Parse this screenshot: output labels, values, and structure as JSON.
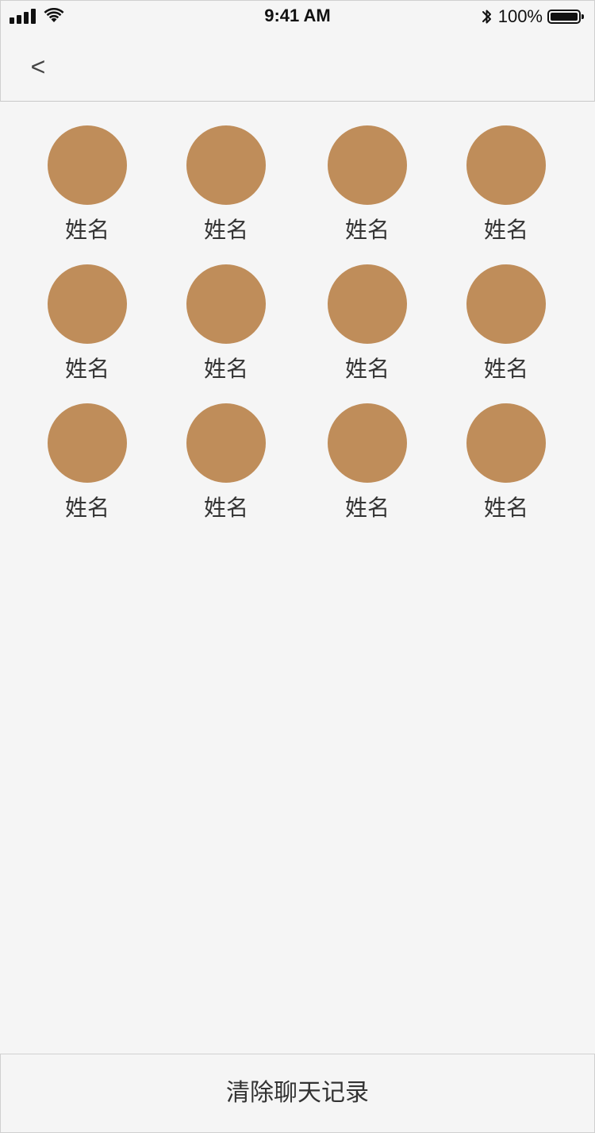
{
  "status_bar": {
    "time": "9:41 AM",
    "battery_percent": "100%",
    "battery_level": 1.0,
    "icons": [
      "signal-icon",
      "wifi-icon",
      "bluetooth-icon",
      "battery-icon"
    ]
  },
  "nav": {
    "back_label": "<"
  },
  "members": [
    {
      "name": "姓名",
      "avatar_color": "#bf8d5a"
    },
    {
      "name": "姓名",
      "avatar_color": "#bf8d5a"
    },
    {
      "name": "姓名",
      "avatar_color": "#bf8d5a"
    },
    {
      "name": "姓名",
      "avatar_color": "#bf8d5a"
    },
    {
      "name": "姓名",
      "avatar_color": "#bf8d5a"
    },
    {
      "name": "姓名",
      "avatar_color": "#bf8d5a"
    },
    {
      "name": "姓名",
      "avatar_color": "#bf8d5a"
    },
    {
      "name": "姓名",
      "avatar_color": "#bf8d5a"
    },
    {
      "name": "姓名",
      "avatar_color": "#bf8d5a"
    },
    {
      "name": "姓名",
      "avatar_color": "#bf8d5a"
    },
    {
      "name": "姓名",
      "avatar_color": "#bf8d5a"
    },
    {
      "name": "姓名",
      "avatar_color": "#bf8d5a"
    }
  ],
  "footer": {
    "clear_label": "清除聊天记录"
  },
  "colors": {
    "background": "#f5f5f5",
    "avatar": "#bf8d5a",
    "border": "#d0d0d0"
  }
}
